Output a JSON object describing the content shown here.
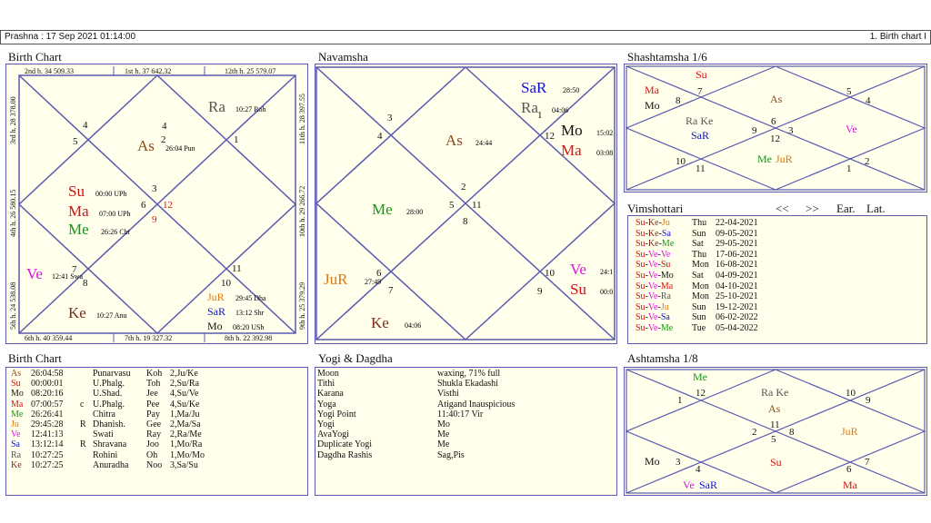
{
  "header": {
    "left": "Prashna :   17 Sep 2021  01:14:00",
    "right": "1. Birth chart I"
  },
  "titles": {
    "birth_chart": "Birth Chart",
    "navamsha": "Navamsha",
    "shashtamsha": "Shashtamsha 1/6",
    "vimshottari": "Vimshottari",
    "birth_table": "Birth Chart",
    "yogi": "Yogi & Dagdha",
    "ashtamsha": "Ashtamsha 1/8"
  },
  "nav": {
    "prev": "<<",
    "next": ">>",
    "early": "Ear.",
    "late": "Lat."
  },
  "birth_chart": {
    "edges": {
      "top1": "2nd h.  34  509.33",
      "top2": "1st h.  37  642.32",
      "top3": "12th h.  25  579.07",
      "bot1": "6th h.  40  359.44",
      "bot2": "7th h.  19  327.32",
      "bot3": "8th h.  22  392.98",
      "left1": "3rd h.  28  378.00",
      "left2": "4th h.  26  580.15",
      "left3": "5th h.  24  538.08",
      "right1": "11th h.  28  397.55",
      "right2": "10th h.  29  266.72",
      "right3": "9th h.  25  379.29"
    },
    "nums": [
      "1",
      "2",
      "3",
      "4",
      "5",
      "6",
      "7",
      "8",
      "9",
      "10",
      "11",
      "12"
    ],
    "planets": {
      "as": {
        "n": "As",
        "d": "26:04  Pun"
      },
      "ra": {
        "n": "Ra",
        "d": "10:27  Roh"
      },
      "su": {
        "n": "Su",
        "d": "00:00  UPh"
      },
      "ma": {
        "n": "Ma",
        "d": "07:00  UPh"
      },
      "me": {
        "n": "Me",
        "d": "26:26  Cht"
      },
      "ve": {
        "n": "Ve",
        "d": "12:41  Swa"
      },
      "ke": {
        "n": "Ke",
        "d": "10:27  Anu"
      },
      "ju": {
        "n": "JuR",
        "d": "29:45  Dha"
      },
      "sa": {
        "n": "SaR",
        "d": "13:12  Shr"
      },
      "mo": {
        "n": "Mo",
        "d": "08:20  USh"
      }
    }
  },
  "navamsha": {
    "nums": [
      "1",
      "2",
      "3",
      "4",
      "5",
      "6",
      "7",
      "8",
      "9",
      "10",
      "11",
      "12",
      "12"
    ],
    "planets": {
      "sa": {
        "n": "SaR",
        "d": "28:50"
      },
      "ra": {
        "n": "Ra",
        "d": "04:06"
      },
      "mo": {
        "n": "Mo",
        "d": "15:02"
      },
      "ma": {
        "n": "Ma",
        "d": "03:08"
      },
      "as": {
        "n": "As",
        "d": "24:44"
      },
      "me": {
        "n": "Me",
        "d": "28:00"
      },
      "ju": {
        "n": "JuR",
        "d": "27:49"
      },
      "ke": {
        "n": "Ke",
        "d": "04:06"
      },
      "ve": {
        "n": "Ve",
        "d": "24:1"
      },
      "su": {
        "n": "Su",
        "d": "00:0"
      }
    }
  },
  "shashtamsha": {
    "nums": [
      "1",
      "2",
      "3",
      "4",
      "5",
      "6",
      "7",
      "8",
      "9",
      "10",
      "11",
      "12"
    ],
    "planets": {
      "su": "Su",
      "ma": "Ma",
      "mo": "Mo",
      "as": "As",
      "rake": "Ra Ke",
      "sa": "SaR",
      "ve": "Ve",
      "me": "Me",
      "ju": "JuR"
    }
  },
  "ashtamsha": {
    "nums": [
      "1",
      "2",
      "3",
      "4",
      "5",
      "6",
      "7",
      "8",
      "9",
      "10",
      "11",
      "12"
    ],
    "planets": {
      "me": "Me",
      "rake": "Ra Ke",
      "as": "As",
      "ju": "JuR",
      "su": "Su",
      "mo": "Mo",
      "vesa_ve": "Ve",
      "vesa_sa": "SaR",
      "ma": "Ma"
    }
  },
  "vimshottari": [
    {
      "a": "Su",
      "b": "Ke",
      "c": "Ju",
      "day": "Thu",
      "date": "22-04-2021"
    },
    {
      "a": "Su",
      "b": "Ke",
      "c": "Sa",
      "day": "Sun",
      "date": "09-05-2021"
    },
    {
      "a": "Su",
      "b": "Ke",
      "c": "Me",
      "day": "Sat",
      "date": "29-05-2021"
    },
    {
      "a": "Su",
      "b": "Ve",
      "c": "Ve",
      "day": "Thu",
      "date": "17-06-2021"
    },
    {
      "a": "Su",
      "b": "Ve",
      "c": "Su",
      "day": "Mon",
      "date": "16-08-2021"
    },
    {
      "a": "Su",
      "b": "Ve",
      "c": "Mo",
      "day": "Sat",
      "date": "04-09-2021"
    },
    {
      "a": "Su",
      "b": "Ve",
      "c": "Ma",
      "day": "Mon",
      "date": "04-10-2021"
    },
    {
      "a": "Su",
      "b": "Ve",
      "c": "Ra",
      "day": "Mon",
      "date": "25-10-2021"
    },
    {
      "a": "Su",
      "b": "Ve",
      "c": "Ju",
      "day": "Sun",
      "date": "19-12-2021"
    },
    {
      "a": "Su",
      "b": "Ve",
      "c": "Sa",
      "day": "Sun",
      "date": "06-02-2022"
    },
    {
      "a": "Su",
      "b": "Ve",
      "c": "Me",
      "day": "Tue",
      "date": "05-04-2022"
    }
  ],
  "birth_table": [
    {
      "p": "As",
      "deg": "26:04:58",
      "r": "",
      "nak": "Punarvasu",
      "pada": "Koh",
      "lord": "2,Ju/Ke"
    },
    {
      "p": "Su",
      "deg": "00:00:01",
      "r": "",
      "nak": "U.Phalg.",
      "pada": "Toh",
      "lord": "2,Su/Ra"
    },
    {
      "p": "Mo",
      "deg": "08:20:16",
      "r": "",
      "nak": "U.Shad.",
      "pada": "Jee",
      "lord": "4,Su/Ve"
    },
    {
      "p": "Ma",
      "deg": "07:00:57",
      "r": "c",
      "nak": "U.Phalg.",
      "pada": "Pee",
      "lord": "4,Su/Ke"
    },
    {
      "p": "Me",
      "deg": "26:26:41",
      "r": "",
      "nak": "Chitra",
      "pada": "Pay",
      "lord": "1,Ma/Ju"
    },
    {
      "p": "Ju",
      "deg": "29:45:28",
      "r": "R",
      "nak": "Dhanish.",
      "pada": "Gee",
      "lord": "2,Ma/Sa"
    },
    {
      "p": "Ve",
      "deg": "12:41:13",
      "r": "",
      "nak": "Swati",
      "pada": "Ray",
      "lord": "2,Ra/Me"
    },
    {
      "p": "Sa",
      "deg": "13:12:14",
      "r": "R",
      "nak": "Shravana",
      "pada": "Joo",
      "lord": "1,Mo/Ra"
    },
    {
      "p": "Ra",
      "deg": "10:27:25",
      "r": "",
      "nak": "Rohini",
      "pada": "Oh",
      "lord": "1,Mo/Mo"
    },
    {
      "p": "Ke",
      "deg": "10:27:25",
      "r": "",
      "nak": "Anuradha",
      "pada": "Noo",
      "lord": "3,Sa/Su"
    }
  ],
  "yogi": [
    {
      "k": "Moon",
      "v": "waxing, 71% full"
    },
    {
      "k": "Tithi",
      "v": "Shukla  Ekadashi"
    },
    {
      "k": "Karana",
      "v": "Visthi"
    },
    {
      "k": "Yoga",
      "v": "Atigand Inauspicious"
    },
    {
      "k": "Yogi Point",
      "v": "11:40:17 Vir"
    },
    {
      "k": "Yogi",
      "v": "Mo"
    },
    {
      "k": "AvaYogi",
      "v": "Me"
    },
    {
      "k": "Duplicate Yogi",
      "v": "Me"
    },
    {
      "k": "Dagdha Rashis",
      "v": "Sag,Pis"
    }
  ],
  "colors": {
    "Su": "#cc1111",
    "Mo": "#111111",
    "Ma": "#dd1111",
    "Me": "#119911",
    "Ju": "#e07a10",
    "Ve": "#dd11dd",
    "Sa": "#1111cc",
    "Ra": "#555555",
    "Ke": "#7a2a1a",
    "As": "#8a4a1a",
    "line": "#5a5ab0",
    "panel": "#ffffec"
  }
}
